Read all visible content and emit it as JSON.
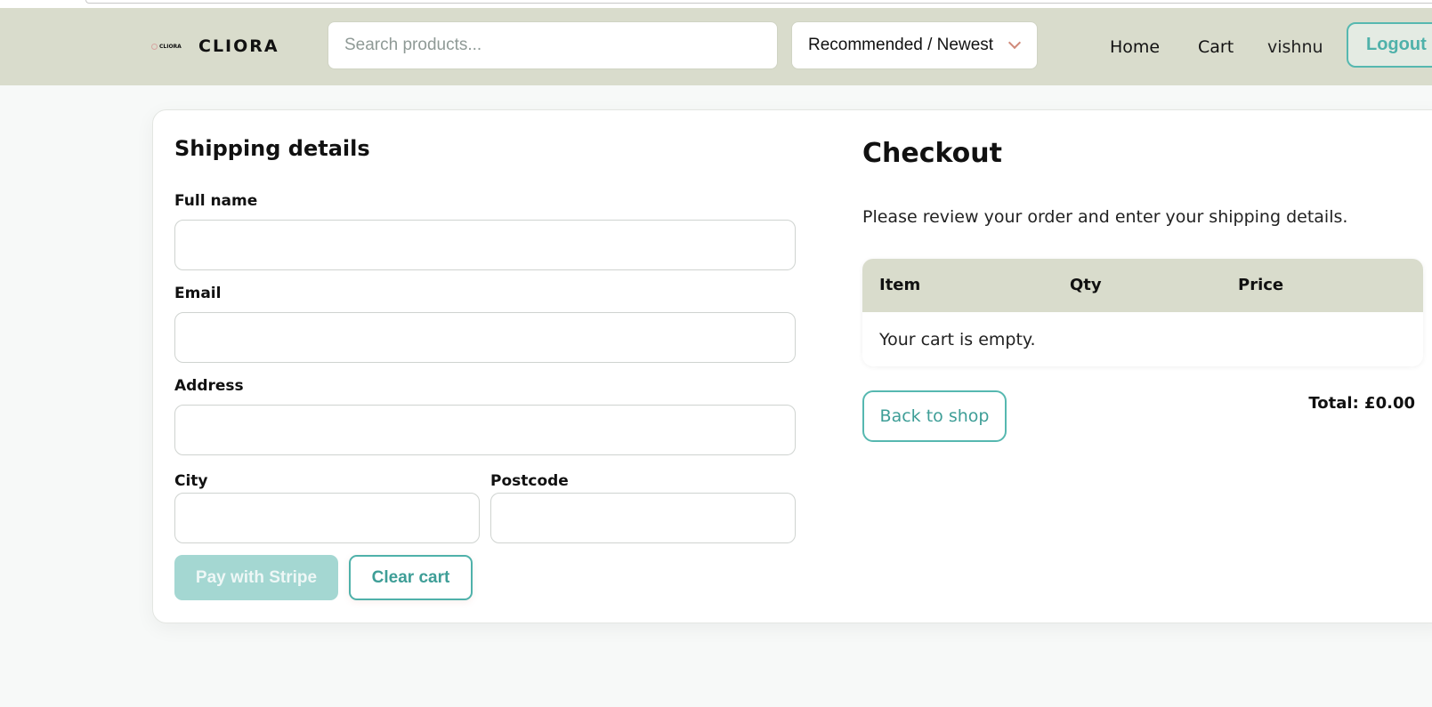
{
  "header": {
    "brand_logo_text": "CLIORA",
    "brand_name": "CLIORA",
    "search_placeholder": "Search products...",
    "sort_selected": "Recommended / Newest",
    "nav": {
      "home": "Home",
      "cart": "Cart",
      "user": "vishnu",
      "logout": "Logout"
    }
  },
  "shipping": {
    "title": "Shipping details",
    "full_name_label": "Full name",
    "email_label": "Email",
    "address_label": "Address",
    "city_label": "City",
    "postcode_label": "Postcode",
    "pay_button": "Pay with Stripe",
    "clear_button": "Clear cart"
  },
  "checkout": {
    "title": "Checkout",
    "description": "Please review your order and enter your shipping details.",
    "columns": [
      "Item",
      "Qty",
      "Price"
    ],
    "empty_message": "Your cart is empty.",
    "back_button": "Back to shop",
    "total": "Total: £0.00"
  },
  "colors": {
    "header_bg": "#d9dccc",
    "accent": "#4fb1aa",
    "pay_disabled": "#a4d7d2"
  }
}
